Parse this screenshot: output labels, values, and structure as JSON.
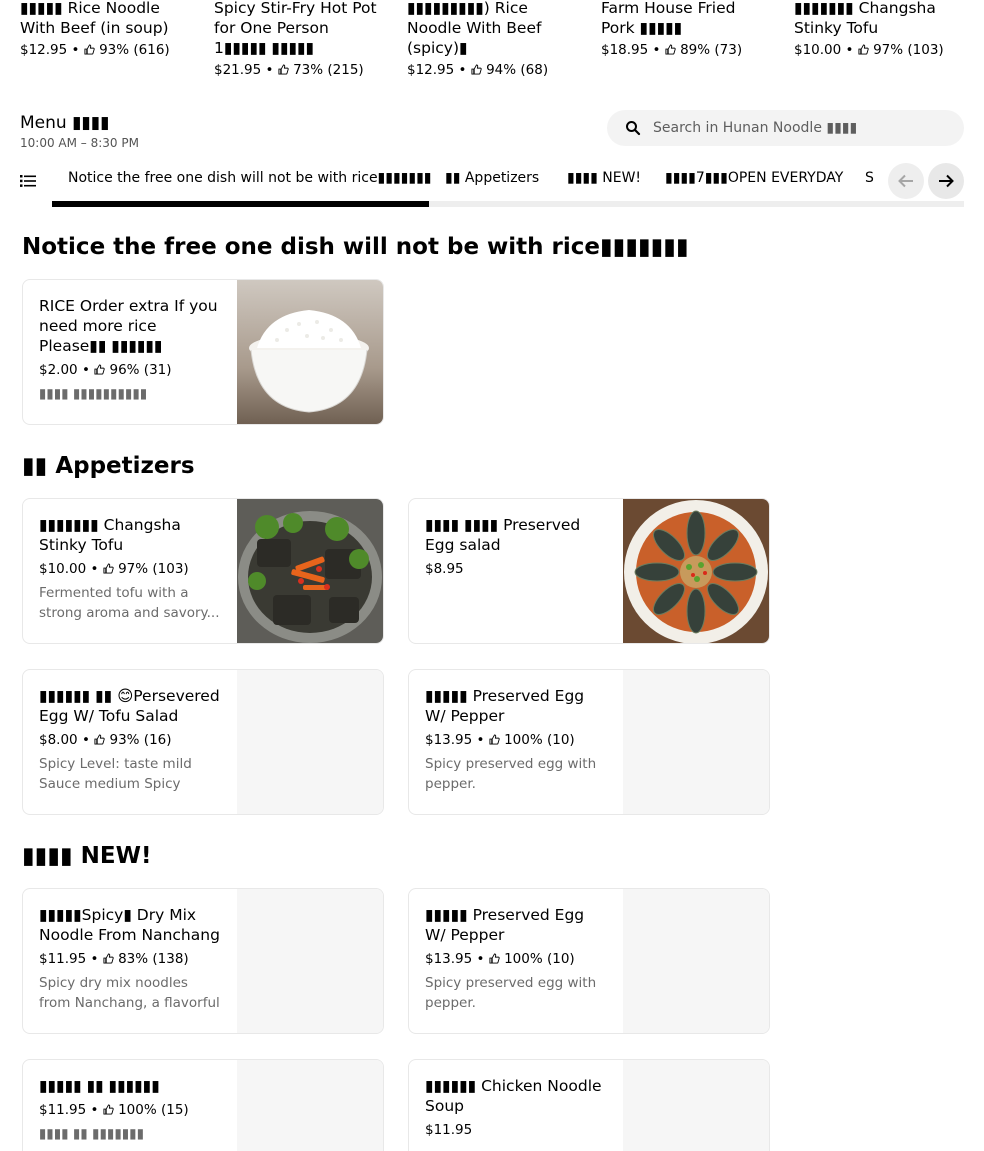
{
  "top_items": [
    {
      "name": "▮▮▮▮▮ Rice Noodle With Beef (in soup)",
      "price": "$12.95",
      "rating": "93% (616)"
    },
    {
      "name": "Spicy Stir-Fry Hot Pot for One Person 1▮▮▮▮▮ ▮▮▮▮▮",
      "price": "$21.95",
      "rating": "73% (215)"
    },
    {
      "name": "▮▮▮▮▮▮▮▮▮) Rice Noodle With Beef (spicy)▮",
      "price": "$12.95",
      "rating": "94% (68)"
    },
    {
      "name": "Farm House Fried Pork ▮▮▮▮▮",
      "price": "$18.95",
      "rating": "89% (73)"
    },
    {
      "name": "▮▮▮▮▮▮▮ Changsha Stinky Tofu",
      "price": "$10.00",
      "rating": "97% (103)"
    }
  ],
  "menu": {
    "title": "Menu ▮▮▮▮",
    "hours": "10:00 AM – 8:30 PM"
  },
  "search": {
    "placeholder": "Search in Hunan Noodle ▮▮▮▮"
  },
  "tabs": [
    {
      "label": "Notice the free one dish will not be with rice▮▮▮▮▮▮▮"
    },
    {
      "label": "▮▮ Appetizers"
    },
    {
      "label": "▮▮▮▮ NEW!"
    },
    {
      "label": "▮▮▮▮7▮▮▮OPEN EVERYDAY"
    },
    {
      "label": "S"
    }
  ],
  "sections": [
    {
      "title": "Notice the free one dish will not be with rice▮▮▮▮▮▮▮",
      "items": [
        {
          "name": "RICE Order extra If you need more rice Please▮▮ ▮▮▮▮▮▮",
          "price": "$2.00",
          "rating": "96% (31)",
          "desc": "▮▮▮▮ ▮▮▮▮▮▮▮▮▮▮",
          "image": "rice-bowl"
        }
      ]
    },
    {
      "title": "▮▮ Appetizers",
      "items": [
        {
          "name": "▮▮▮▮▮▮▮ Changsha Stinky Tofu",
          "price": "$10.00",
          "rating": "97% (103)",
          "desc": "Fermented tofu with a strong aroma and savory...",
          "image": "stinky-tofu"
        },
        {
          "name": "▮▮▮▮ ▮▮▮▮  Preserved Egg salad",
          "price": "$8.95",
          "rating": "",
          "desc": "",
          "image": "preserved-egg"
        },
        {
          "name": "▮▮▮▮▮▮ ▮▮ 😊Persevered Egg  W/ Tofu Salad",
          "price": "$8.00",
          "rating": "93% (16)",
          "desc": "Spicy Level: taste mild Sauce medium Spicy",
          "image": ""
        },
        {
          "name": "▮▮▮▮▮ Preserved Egg W/ Pepper",
          "price": "$13.95",
          "rating": "100% (10)",
          "desc": "Spicy preserved egg with pepper.",
          "image": ""
        }
      ]
    },
    {
      "title": "▮▮▮▮ NEW!",
      "items": [
        {
          "name": "▮▮▮▮▮Spicy▮ Dry Mix Noodle From Nanchang",
          "price": "$11.95",
          "rating": "83% (138)",
          "desc": "Spicy dry mix noodles from Nanchang, a flavorful and...",
          "image": ""
        },
        {
          "name": "▮▮▮▮▮ Preserved Egg W/ Pepper",
          "price": "$13.95",
          "rating": "100% (10)",
          "desc": "Spicy preserved egg with pepper.",
          "image": ""
        },
        {
          "name": "▮▮▮▮▮  ▮▮ ▮▮▮▮▮▮",
          "price": "$11.95",
          "rating": "100% (15)",
          "desc": "▮▮▮▮ ▮▮ ▮▮▮▮▮▮▮",
          "image": ""
        },
        {
          "name": "▮▮▮▮▮▮ Chicken Noodle Soup",
          "price": "$11.95",
          "rating": "",
          "desc": "",
          "image": ""
        }
      ]
    }
  ],
  "icons": {
    "search": "search-icon",
    "list": "list-icon",
    "thumb": "thumbs-up-icon",
    "prev": "arrow-left-icon",
    "next": "arrow-right-icon"
  }
}
